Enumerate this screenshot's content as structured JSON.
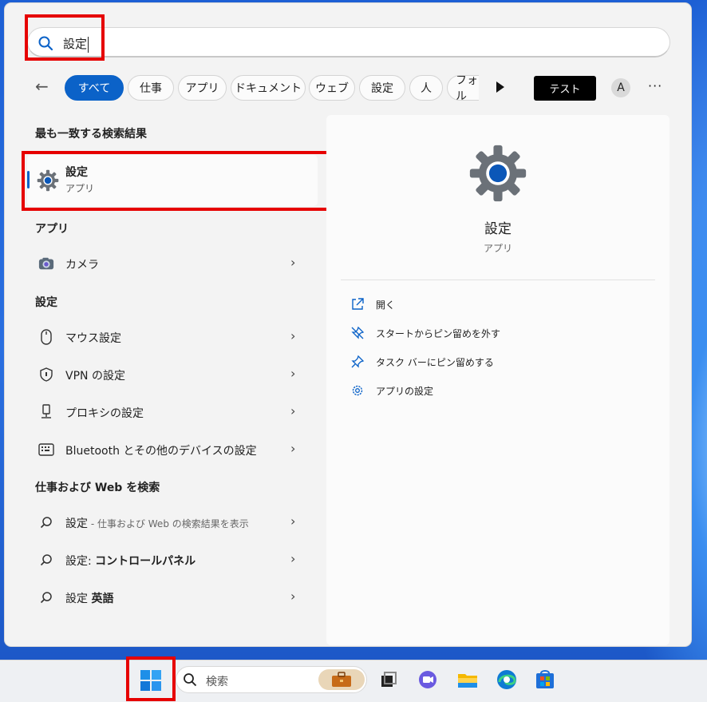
{
  "search": {
    "query": "設定",
    "icon": "search-icon"
  },
  "filters": {
    "back_icon": "back-arrow-icon",
    "chips": [
      "すべて",
      "仕事",
      "アプリ",
      "ドキュメント",
      "ウェブ",
      "設定",
      "人",
      "フォル"
    ],
    "test_label": "テスト",
    "avatar_letter": "A",
    "more_label": "···"
  },
  "best_match": {
    "heading": "最も一致する検索結果",
    "title": "設定",
    "subtitle": "アプリ",
    "icon": "gear-icon"
  },
  "apps": {
    "heading": "アプリ",
    "items": [
      {
        "label": "カメラ",
        "icon": "camera-icon"
      }
    ]
  },
  "settings": {
    "heading": "設定",
    "items": [
      {
        "label": "マウス設定",
        "icon": "mouse-icon"
      },
      {
        "label": "VPN の設定",
        "icon": "shield-icon"
      },
      {
        "label": "プロキシの設定",
        "icon": "proxy-icon"
      },
      {
        "label": "Bluetooth とその他のデバイスの設定",
        "icon": "keyboard-device-icon"
      }
    ]
  },
  "web": {
    "heading": "仕事および Web を検索",
    "items": [
      {
        "main": "設定",
        "sub": " - 仕事および Web の検索結果を表示"
      },
      {
        "main": "設定: ",
        "bold": "コントロールパネル"
      },
      {
        "main": "設定 ",
        "bold": "英語"
      }
    ]
  },
  "preview": {
    "title": "設定",
    "subtitle": "アプリ",
    "actions": [
      {
        "label": "開く",
        "icon": "open-external-icon"
      },
      {
        "label": "スタートからピン留めを外す",
        "icon": "unpin-icon"
      },
      {
        "label": "タスク バーにピン留めする",
        "icon": "pin-icon"
      },
      {
        "label": "アプリの設定",
        "icon": "gear-icon"
      }
    ]
  },
  "taskbar": {
    "search_placeholder": "検索"
  },
  "colors": {
    "accent": "#0b62c8",
    "highlight": "#e60000"
  },
  "chevron": "›"
}
